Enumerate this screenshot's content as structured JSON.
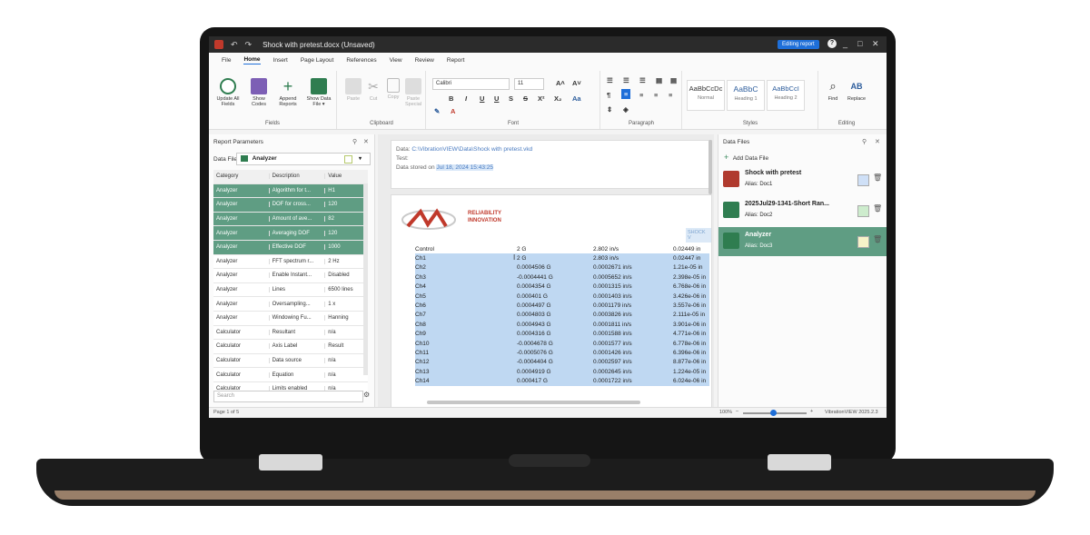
{
  "window": {
    "title": "Shock with pretest.docx (Unsaved)",
    "editing_badge": "Editing report",
    "help": "?",
    "minimize": "_",
    "maximize": "□",
    "close": "✕"
  },
  "menu": [
    "File",
    "Home",
    "Insert",
    "Page Layout",
    "References",
    "View",
    "Review",
    "Report"
  ],
  "menu_active": "Home",
  "ribbon": {
    "fields": {
      "group_label": "Fields",
      "buttons": [
        "Update All Fields",
        "Show Codes",
        "Append Reports",
        "Show Data File ▾"
      ]
    },
    "clipboard": {
      "group_label": "Clipboard",
      "buttons": [
        "Paste",
        "Cut",
        "Copy",
        "Paste Special"
      ]
    },
    "font": {
      "group_label": "Font",
      "family": "Calibri",
      "size": "11",
      "bold": "B",
      "italic": "I",
      "underline": "U",
      "double_underline": "U",
      "strike": "S",
      "strike2": "S",
      "superscript": "X²",
      "subscript": "X₂",
      "case": "Aa",
      "grow": "A˄",
      "shrink": "A˅"
    },
    "paragraph": {
      "group_label": "Paragraph",
      "pilcrow": "¶"
    },
    "styles": {
      "group_label": "Styles",
      "items": [
        {
          "sample": "AaBbCcDc",
          "name": "Normal"
        },
        {
          "sample": "AaBbC",
          "name": "Heading 1"
        },
        {
          "sample": "AaBbCcI",
          "name": "Heading 2"
        }
      ]
    },
    "editing": {
      "group_label": "Editing",
      "buttons": [
        "Find",
        "Replace"
      ]
    }
  },
  "left_panel": {
    "title": "Report Parameters",
    "data_file_label": "Data File:",
    "data_file_value": "Analyzer",
    "columns": [
      "Category",
      "Description",
      "Value"
    ],
    "rows": [
      {
        "cat": "Analyzer",
        "desc": "Algorithm for t...",
        "val": "H1",
        "selected": true
      },
      {
        "cat": "Analyzer",
        "desc": "DOF for cross...",
        "val": "120",
        "selected": true
      },
      {
        "cat": "Analyzer",
        "desc": "Amount of ave...",
        "val": "82",
        "selected": true
      },
      {
        "cat": "Analyzer",
        "desc": "Averaging DOF",
        "val": "120",
        "selected": true
      },
      {
        "cat": "Analyzer",
        "desc": "Effective DOF",
        "val": "1000",
        "selected": true
      },
      {
        "cat": "Analyzer",
        "desc": "FFT spectrum r...",
        "val": "2 Hz",
        "selected": false
      },
      {
        "cat": "Analyzer",
        "desc": "Enable Instant...",
        "val": "Disabled",
        "selected": false
      },
      {
        "cat": "Analyzer",
        "desc": "Lines",
        "val": "6500 lines",
        "selected": false
      },
      {
        "cat": "Analyzer",
        "desc": "Oversampling...",
        "val": "1 x",
        "selected": false
      },
      {
        "cat": "Analyzer",
        "desc": "Windowing Fu...",
        "val": "Hanning",
        "selected": false
      },
      {
        "cat": "Calculator",
        "desc": "Resultant",
        "val": "n/a",
        "selected": false
      },
      {
        "cat": "Calculator",
        "desc": "Axis Label",
        "val": "Result",
        "selected": false
      },
      {
        "cat": "Calculator",
        "desc": "Data source",
        "val": "n/a",
        "selected": false
      },
      {
        "cat": "Calculator",
        "desc": "Equation",
        "val": "n/a",
        "selected": false
      },
      {
        "cat": "Calculator",
        "desc": "Limits enabled",
        "val": "n/a",
        "selected": false
      }
    ],
    "search_placeholder": "Search"
  },
  "document": {
    "data_label": "Data:",
    "data_path": "C:\\VibrationVIEW\\Data\\Shock with pretest.vkd",
    "test_label": "Test:",
    "stored_label": "Data stored on",
    "stored_date": "Jul 18, 2024 15:43:25",
    "logo_text_1": "RELIABILITY",
    "logo_text_2": "INNOVATION",
    "logo_tag": "SHOCK V",
    "table": [
      [
        "Control",
        "2 G",
        "2.802 in/s",
        "0.02449 in"
      ],
      [
        "Ch1",
        "2 G",
        "2.803 in/s",
        "0.02447 in"
      ],
      [
        "Ch2",
        "0.0004506 G",
        "0.0002671 in/s",
        "1.21e-05 in"
      ],
      [
        "Ch3",
        "-0.0004441 G",
        "0.0005652 in/s",
        "2.398e-05 in"
      ],
      [
        "Ch4",
        "0.0004354 G",
        "0.0001315 in/s",
        "6.768e-06 in"
      ],
      [
        "Ch5",
        "0.000401 G",
        "0.0001403 in/s",
        "3.426e-06 in"
      ],
      [
        "Ch6",
        "0.0004497 G",
        "0.0001179 in/s",
        "3.557e-06 in"
      ],
      [
        "Ch7",
        "0.0004803 G",
        "0.0003826 in/s",
        "2.111e-05 in"
      ],
      [
        "Ch8",
        "0.0004943 G",
        "0.0001811 in/s",
        "3.901e-06 in"
      ],
      [
        "Ch9",
        "0.0004316 G",
        "0.0001588 in/s",
        "4.771e-06 in"
      ],
      [
        "Ch10",
        "-0.0004678 G",
        "0.0001577 in/s",
        "6.778e-06 in"
      ],
      [
        "Ch11",
        "-0.0005076 G",
        "0.0001426 in/s",
        "6.396e-06 in"
      ],
      [
        "Ch12",
        "-0.0004404 G",
        "0.0002597 in/s",
        "8.877e-06 in"
      ],
      [
        "Ch13",
        "0.0004919 G",
        "0.0002645 in/s",
        "1.224e-05 in"
      ],
      [
        "Ch14",
        "0.000417 G",
        "0.0001722 in/s",
        "6.024e-06 in"
      ]
    ]
  },
  "right_panel": {
    "title": "Data Files",
    "add_label": "Add Data File",
    "files": [
      {
        "name": "Shock with pretest",
        "alias": "Alias: Doc1",
        "swatch": "#cfe0f7",
        "icon_color": "#b03a2e",
        "selected": false
      },
      {
        "name": "2025Jul29-1341-Short Ran...",
        "alias": "Alias: Doc2",
        "swatch": "#cdeccd",
        "icon_color": "#2f7d50",
        "selected": false
      },
      {
        "name": "Analyzer",
        "alias": "Alias: Doc3",
        "swatch": "#f6f3c8",
        "icon_color": "#2f7d50",
        "selected": true
      }
    ]
  },
  "status": {
    "page": "Page 1 of 5",
    "zoom": "100%",
    "version": "VibrationVIEW 2025.2.3"
  },
  "colors": {
    "selection_green": "#5f9d83",
    "accent_blue": "#1e6fd9",
    "table_highlight": "#bfd8f2"
  }
}
